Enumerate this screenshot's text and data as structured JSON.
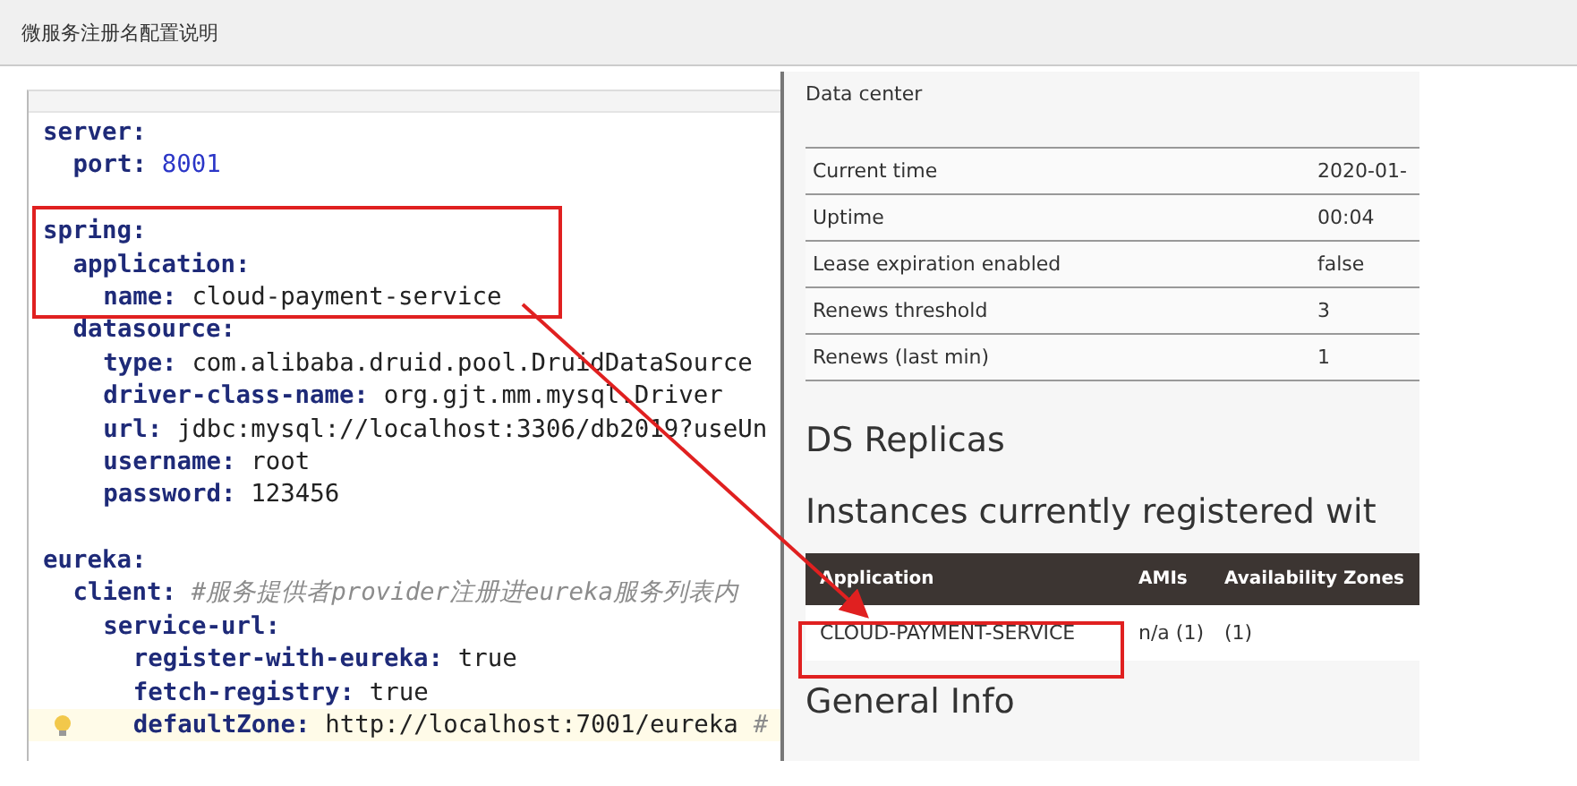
{
  "window": {
    "title": "微服务注册名配置说明"
  },
  "editor": {
    "lines": [
      {
        "key": "server:",
        "children": [
          {
            "key": "port:",
            "value": "8001",
            "kind": "number"
          }
        ]
      },
      {
        "key": "spring:",
        "children": [
          {
            "key": "application:",
            "children": [
              {
                "key": "name:",
                "value": "cloud-payment-service",
                "kind": "string"
              }
            ]
          },
          {
            "key": "datasource:",
            "children": [
              {
                "key": "type:",
                "value": "com.alibaba.druid.pool.DruidDataSource",
                "kind": "string"
              },
              {
                "key": "driver-class-name:",
                "value": "org.gjt.mm.mysql.Driver",
                "kind": "string"
              },
              {
                "key": "url:",
                "value": "jdbc:mysql://localhost:3306/db2019?useUn",
                "kind": "string"
              },
              {
                "key": "username:",
                "value": "root",
                "kind": "string"
              },
              {
                "key": "password:",
                "value": "123456",
                "kind": "string"
              }
            ]
          }
        ]
      },
      {
        "key": "eureka:",
        "children": [
          {
            "key": "client:",
            "comment": "#服务提供者provider注册进eureka服务列表内",
            "children": [
              {
                "key": "service-url:",
                "children": [
                  {
                    "key": "register-with-eureka:",
                    "value": "true",
                    "kind": "string"
                  },
                  {
                    "key": "fetch-registry:",
                    "value": "true",
                    "kind": "string"
                  },
                  {
                    "key": "defaultZone:",
                    "value": "http://localhost:7001/eureka",
                    "comment": "#",
                    "kind": "string",
                    "current": true
                  }
                ]
              }
            ]
          }
        ]
      }
    ]
  },
  "eureka": {
    "data_center": "Data center",
    "status_rows": [
      {
        "label": "Current time",
        "value": "2020-01-"
      },
      {
        "label": "Uptime",
        "value": "00:04"
      },
      {
        "label": "Lease expiration enabled",
        "value": "false"
      },
      {
        "label": "Renews threshold",
        "value": "3"
      },
      {
        "label": "Renews (last min)",
        "value": "1"
      }
    ],
    "replicas_heading": "DS Replicas",
    "instances_heading": "Instances currently registered wit",
    "instances_table": {
      "columns": [
        "Application",
        "AMIs",
        "Availability Zones"
      ],
      "rows": [
        [
          "CLOUD-PAYMENT-SERVICE",
          "n/a (1)",
          "(1)"
        ]
      ]
    },
    "general_heading": "General Info"
  }
}
